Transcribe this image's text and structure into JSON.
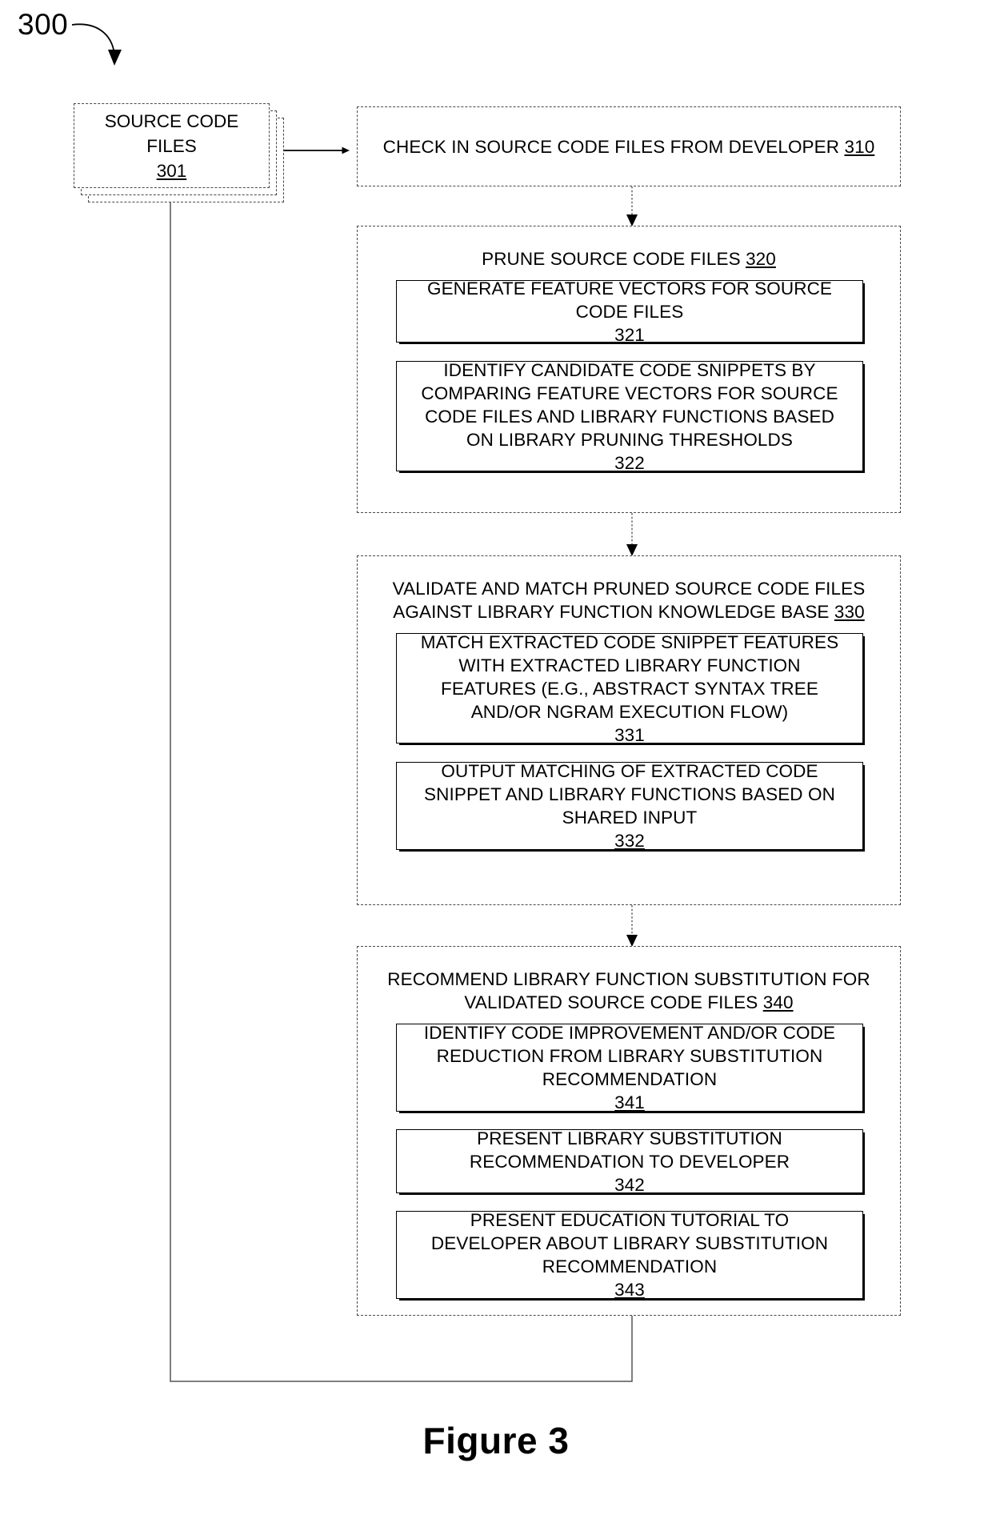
{
  "figure": {
    "reference_numeral": "300",
    "caption": "Figure 3"
  },
  "nodes": {
    "source_files": {
      "label": "SOURCE CODE\nFILES 301",
      "numeral": "301",
      "shape": "stacked-document",
      "border": "dashed"
    },
    "step_310": {
      "label": "CHECK IN SOURCE CODE FILES FROM DEVELOPER 310",
      "numeral": "310",
      "border": "dashed"
    },
    "step_320": {
      "label": "PRUNE SOURCE CODE FILES 320",
      "numeral": "320",
      "border": "dashed",
      "substeps": [
        {
          "label": "GENERATE FEATURE VECTORS FOR SOURCE\nCODE FILES 321",
          "numeral": "321"
        },
        {
          "label": "IDENTIFY CANDIDATE CODE SNIPPETS BY\nCOMPARING FEATURE VECTORS FOR SOURCE\nCODE FILES AND LIBRARY FUNCTIONS BASED\nON LIBRARY PRUNING THRESHOLDS 322",
          "numeral": "322"
        }
      ]
    },
    "step_330": {
      "label": "VALIDATE AND MATCH PRUNED SOURCE CODE FILES\nAGAINST LIBRARY FUNCTION KNOWLEDGE BASE 330",
      "numeral": "330",
      "border": "dashed",
      "substeps": [
        {
          "label": "MATCH EXTRACTED CODE SNIPPET FEATURES\nWITH EXTRACTED LIBRARY FUNCTION\nFEATURES (E.G., ABSTRACT SYNTAX TREE\nAND/OR NGRAM EXECUTION FLOW) 331",
          "numeral": "331"
        },
        {
          "label": "OUTPUT MATCHING OF EXTRACTED CODE\nSNIPPET AND LIBRARY FUNCTIONS BASED ON\nSHARED INPUT 332",
          "numeral": "332"
        }
      ]
    },
    "step_340": {
      "label": "RECOMMEND LIBRARY FUNCTION SUBSTITUTION FOR\nVALIDATED SOURCE CODE FILES 340",
      "numeral": "340",
      "border": "dashed",
      "substeps": [
        {
          "label": "IDENTIFY CODE IMPROVEMENT AND/OR CODE\nREDUCTION FROM LIBRARY SUBSTITUTION\nRECOMMENDATION 341",
          "numeral": "341"
        },
        {
          "label": "PRESENT LIBRARY SUBSTITUTION\nRECOMMENDATION TO DEVELOPER 342",
          "numeral": "342"
        },
        {
          "label": "PRESENT EDUCATION TUTORIAL TO\nDEVELOPER ABOUT LIBRARY SUBSTITUTION\nRECOMMENDATION 343",
          "numeral": "343"
        }
      ]
    }
  },
  "connectors": [
    {
      "name": "files-to-310",
      "from": "source_files",
      "to": "step_310",
      "direction": "right"
    },
    {
      "name": "310-to-320",
      "from": "step_310",
      "to": "step_320",
      "direction": "down"
    },
    {
      "name": "320-to-330",
      "from": "step_320",
      "to": "step_330",
      "direction": "down"
    },
    {
      "name": "330-to-340",
      "from": "step_330",
      "to": "step_340",
      "direction": "down"
    },
    {
      "name": "340-feedback-to-files",
      "from": "step_340",
      "to": "source_files",
      "direction": "up-left-loop"
    }
  ],
  "colors": {
    "stroke": "#000000",
    "dashed_stroke": "#4a4a4a",
    "background": "#ffffff"
  }
}
